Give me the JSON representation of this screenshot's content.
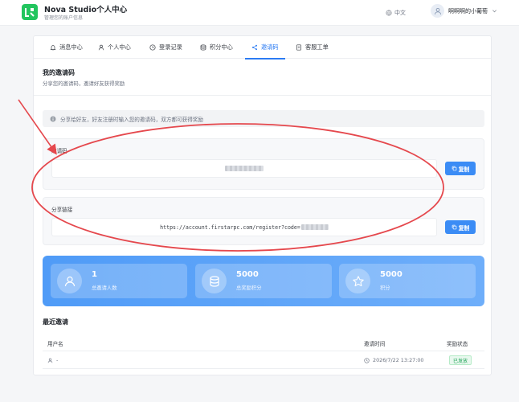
{
  "header": {
    "title": "Nova Studio个人中心",
    "subtitle": "管理您的账户信息",
    "language": "中文",
    "username": "啊啊啊的小葡萄"
  },
  "tabs": [
    {
      "label": "消息中心",
      "icon": "bell-icon"
    },
    {
      "label": "个人中心",
      "icon": "user-icon"
    },
    {
      "label": "登录记录",
      "icon": "clock-icon"
    },
    {
      "label": "积分中心",
      "icon": "database-icon"
    },
    {
      "label": "邀请码",
      "icon": "share-icon",
      "active": true
    },
    {
      "label": "客服工单",
      "icon": "document-icon"
    }
  ],
  "invite": {
    "title": "我的邀请码",
    "subtitle": "分享您的邀请码，邀请好友获得奖励",
    "tip": "分享给好友，好友注册时输入您的邀请码，双方都可获得奖励",
    "code_label": "邀请码",
    "link_label": "分享链接",
    "link_value": "https://account.firstarpc.com/register?code=",
    "copy_label": "复制"
  },
  "stats": [
    {
      "value": "1",
      "label": "总邀请人数",
      "icon": "user-icon"
    },
    {
      "value": "5000",
      "label": "总奖励积分",
      "icon": "coins-icon"
    },
    {
      "value": "5000",
      "label": "积分",
      "icon": "star-icon"
    }
  ],
  "recent": {
    "title": "最近邀请",
    "columns": [
      "用户名",
      "邀请时间",
      "奖励状态"
    ],
    "rows": [
      {
        "username": "-",
        "time": "2026/7/22 13:27:00",
        "status": "已发放"
      }
    ]
  },
  "colors": {
    "accent": "#2b7bf3",
    "brand": "#22c55e",
    "annotation": "#e5484d"
  }
}
